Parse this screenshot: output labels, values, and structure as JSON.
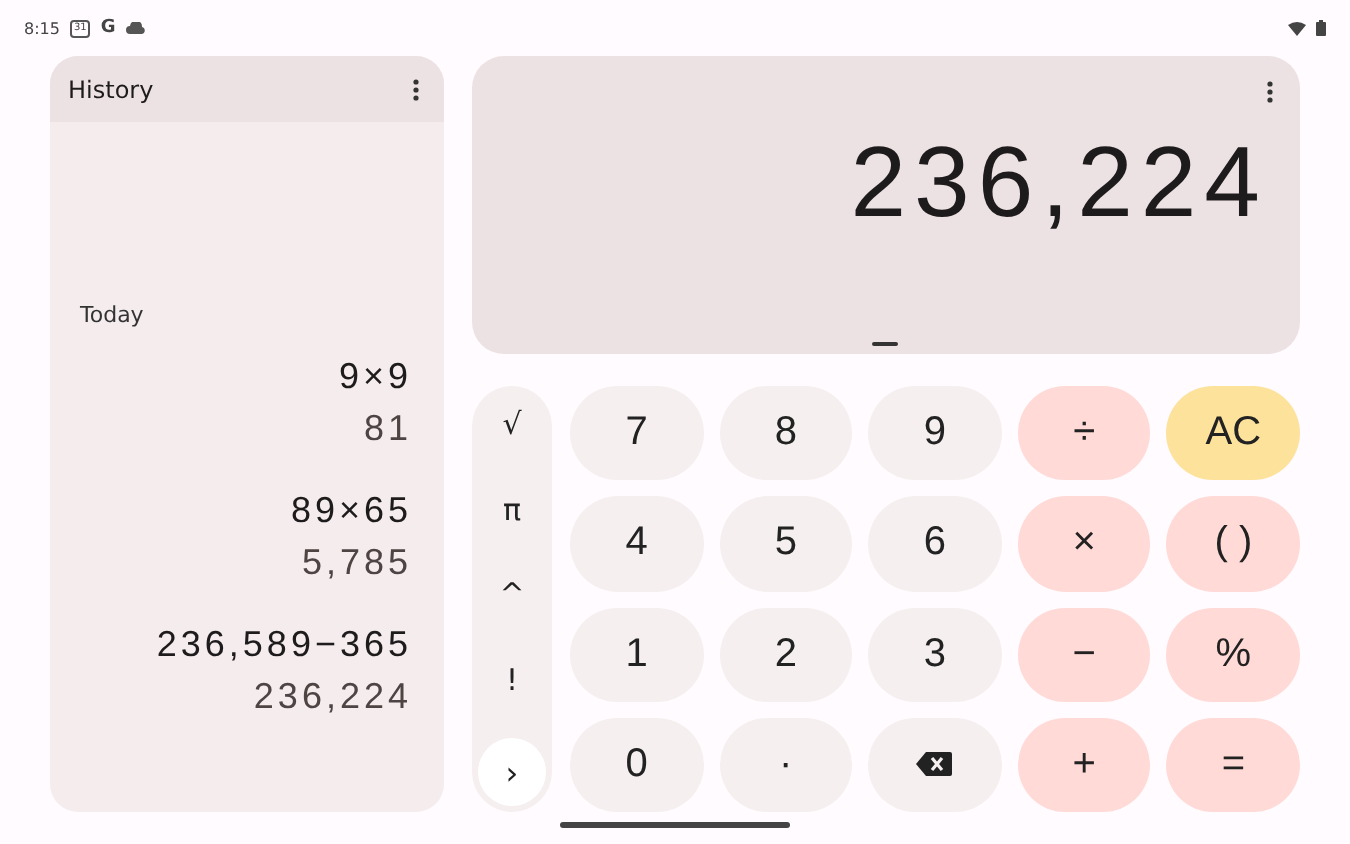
{
  "status_bar": {
    "time": "8:15",
    "calendar_day": "31",
    "app_letter": "G"
  },
  "history": {
    "title": "History",
    "section": "Today",
    "entries": [
      {
        "expression": "9×9",
        "result": "81"
      },
      {
        "expression": "89×65",
        "result": "5,785"
      },
      {
        "expression": "236,589−365",
        "result": "236,224"
      }
    ]
  },
  "display": {
    "value": "236,224"
  },
  "side_keys": [
    {
      "label": "√",
      "kind": "fn"
    },
    {
      "label": "π",
      "kind": "fn"
    },
    {
      "label": "^",
      "kind": "fn"
    },
    {
      "label": "!",
      "kind": "fn"
    },
    {
      "label": "›",
      "kind": "expand"
    }
  ],
  "keys": [
    {
      "label": "7",
      "kind": "digit"
    },
    {
      "label": "8",
      "kind": "digit"
    },
    {
      "label": "9",
      "kind": "digit"
    },
    {
      "label": "÷",
      "kind": "op"
    },
    {
      "label": "AC",
      "kind": "clear"
    },
    {
      "label": "4",
      "kind": "digit"
    },
    {
      "label": "5",
      "kind": "digit"
    },
    {
      "label": "6",
      "kind": "digit"
    },
    {
      "label": "×",
      "kind": "op"
    },
    {
      "label": "( )",
      "kind": "op"
    },
    {
      "label": "1",
      "kind": "digit"
    },
    {
      "label": "2",
      "kind": "digit"
    },
    {
      "label": "3",
      "kind": "digit"
    },
    {
      "label": "−",
      "kind": "op"
    },
    {
      "label": "%",
      "kind": "op"
    },
    {
      "label": "0",
      "kind": "digit"
    },
    {
      "label": "·",
      "kind": "digit"
    },
    {
      "kind": "backspace"
    },
    {
      "label": "+",
      "kind": "op"
    },
    {
      "label": "=",
      "kind": "op"
    }
  ]
}
